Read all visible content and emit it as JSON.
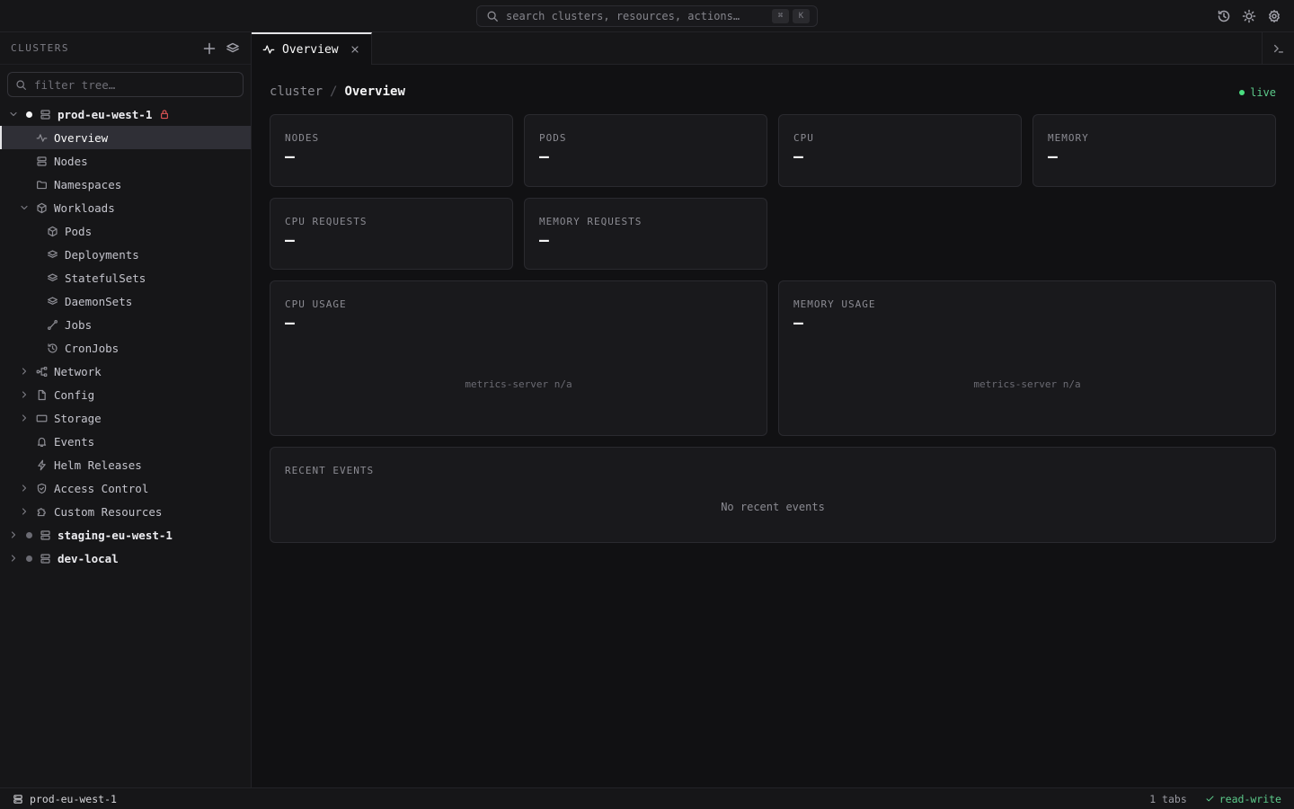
{
  "search": {
    "placeholder": "search clusters, resources, actions…",
    "kbd_mod": "⌘",
    "kbd_key": "K"
  },
  "sidebar": {
    "title": "CLUSTERS",
    "filter_placeholder": "filter tree…",
    "clusters": [
      {
        "name": "prod-eu-west-1",
        "status_color": "#f4f4f5",
        "expanded": true,
        "locked": true,
        "items": [
          {
            "label": "Overview",
            "icon": "activity-icon",
            "active": true
          },
          {
            "label": "Nodes",
            "icon": "server-icon"
          },
          {
            "label": "Namespaces",
            "icon": "folder-icon"
          },
          {
            "label": "Workloads",
            "icon": "cube-icon",
            "expanded": true,
            "children": [
              {
                "label": "Pods",
                "icon": "cube-icon"
              },
              {
                "label": "Deployments",
                "icon": "layers-icon"
              },
              {
                "label": "StatefulSets",
                "icon": "layers-icon"
              },
              {
                "label": "DaemonSets",
                "icon": "layers-icon"
              },
              {
                "label": "Jobs",
                "icon": "route-icon"
              },
              {
                "label": "CronJobs",
                "icon": "history-icon"
              }
            ]
          },
          {
            "label": "Network",
            "icon": "network-icon",
            "collapsible": true
          },
          {
            "label": "Config",
            "icon": "file-icon",
            "collapsible": true
          },
          {
            "label": "Storage",
            "icon": "storage-icon",
            "collapsible": true
          },
          {
            "label": "Events",
            "icon": "bell-icon"
          },
          {
            "label": "Helm Releases",
            "icon": "bolt-icon"
          },
          {
            "label": "Access Control",
            "icon": "shield-icon",
            "collapsible": true
          },
          {
            "label": "Custom Resources",
            "icon": "puzzle-icon",
            "collapsible": true
          }
        ]
      },
      {
        "name": "staging-eu-west-1",
        "status_color": "#6b6b73",
        "expanded": false
      },
      {
        "name": "dev-local",
        "status_color": "#6b6b73",
        "expanded": false
      }
    ]
  },
  "tabs": [
    {
      "label": "Overview",
      "icon": "activity-icon"
    }
  ],
  "main": {
    "breadcrumb": {
      "parent": "cluster",
      "separator": "/",
      "current": "Overview"
    },
    "live_label": "live",
    "stats": [
      {
        "title": "NODES",
        "value": "—"
      },
      {
        "title": "PODS",
        "value": "—"
      },
      {
        "title": "CPU",
        "value": "—"
      },
      {
        "title": "MEMORY",
        "value": "—"
      },
      {
        "title": "CPU REQUESTS",
        "value": "—"
      },
      {
        "title": "MEMORY REQUESTS",
        "value": "—"
      }
    ],
    "usage": [
      {
        "title": "CPU USAGE",
        "value": "—",
        "note": "metrics-server n/a"
      },
      {
        "title": "MEMORY USAGE",
        "value": "—",
        "note": "metrics-server n/a"
      }
    ],
    "events": {
      "title": "RECENT EVENTS",
      "empty": "No recent events"
    }
  },
  "statusbar": {
    "cluster": "prod-eu-west-1",
    "tabs": "1 tabs",
    "mode": "read-write"
  },
  "colors": {
    "accent_green": "#4ade80",
    "lock_red": "#e05555"
  }
}
